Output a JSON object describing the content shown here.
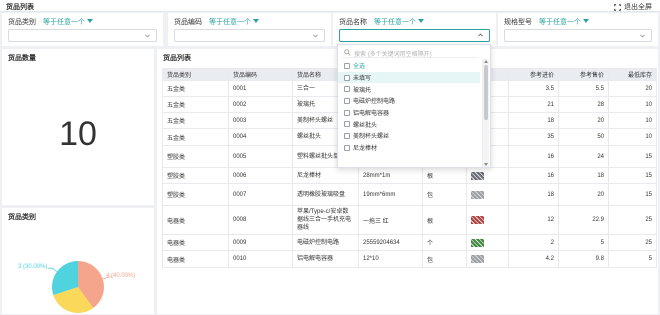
{
  "header": {
    "title": "货品列表",
    "fullscreen_label": "退出全屏"
  },
  "filters": [
    {
      "label": "货品类别",
      "operator": "等于任意一个",
      "value": ""
    },
    {
      "label": "货品编码",
      "operator": "等于任意一个",
      "value": ""
    },
    {
      "label": "货品名称",
      "operator": "等于任意一个",
      "value": ""
    },
    {
      "label": "规格型号",
      "operator": "等于任意一个",
      "value": ""
    }
  ],
  "count_panel": {
    "title": "货品数量",
    "value": "10"
  },
  "category_panel": {
    "title": "货品类别"
  },
  "chart_data": {
    "type": "pie",
    "title": "",
    "slices": [
      {
        "label": "4 (40.00%)",
        "value": 4,
        "color": "#f5a58c"
      },
      {
        "label": "3 (30.00%)",
        "value": 3,
        "color": "#f9d85a"
      },
      {
        "label": "3 (30.00%)",
        "value": 3,
        "color": "#4fd3de"
      }
    ]
  },
  "table": {
    "title": "货品列表",
    "columns": [
      "货品类别",
      "货品编码",
      "货品名称",
      "规格型号",
      "单位",
      "图片",
      "参考进价",
      "参考售价",
      "最低库存"
    ],
    "rows": [
      [
        "五金类",
        "0001",
        "三合一",
        "",
        "",
        "",
        "3.5",
        "5.5",
        "20"
      ],
      [
        "五金类",
        "0002",
        "玻璃托",
        "",
        "",
        "",
        "21",
        "28",
        "10"
      ],
      [
        "五金类",
        "0003",
        "美制杯头螺丝",
        "",
        "",
        "",
        "18",
        "20",
        "10"
      ],
      [
        "五金类",
        "0004",
        "螺丝批头",
        "",
        "",
        "",
        "35",
        "50",
        "10"
      ],
      [
        "塑胶类",
        "0005",
        "塑料螺丝批头单螺丝",
        "9*45",
        "",
        "",
        "16",
        "24",
        "15"
      ],
      [
        "塑胶类",
        "0006",
        "尼龙棒材",
        "28mm*1m",
        "根",
        "",
        "16",
        "18",
        "15"
      ],
      [
        "塑胶类",
        "0007",
        "透明橡胶玻璃吸盘",
        "19mm*6mm",
        "包",
        "",
        "18",
        "20",
        "15"
      ],
      [
        "电器类",
        "0008",
        "苹果/Type-c/安卓数据线三合一手机充电器线",
        "一拖三 红",
        "根",
        "",
        "12",
        "22.9",
        "25"
      ],
      [
        "电器类",
        "0009",
        "电磁炉控制电路",
        "25559204634",
        "个",
        "",
        "2",
        "5",
        "25"
      ],
      [
        "电器类",
        "0010",
        "铝电解电容器",
        "12*10",
        "包",
        "",
        "4.2",
        "9.8",
        "5"
      ]
    ]
  },
  "dropdown": {
    "search_placeholder": "搜索 (多个关键词用空格隔开)",
    "options": [
      {
        "label": "全选",
        "style": "teal"
      },
      {
        "label": "未填写",
        "style": "highlight"
      },
      {
        "label": "玻璃托",
        "style": ""
      },
      {
        "label": "电磁炉控制电路",
        "style": ""
      },
      {
        "label": "铝电解电容器",
        "style": ""
      },
      {
        "label": "螺丝批头",
        "style": ""
      },
      {
        "label": "美制杯头螺丝",
        "style": ""
      },
      {
        "label": "尼龙棒材",
        "style": ""
      }
    ]
  }
}
